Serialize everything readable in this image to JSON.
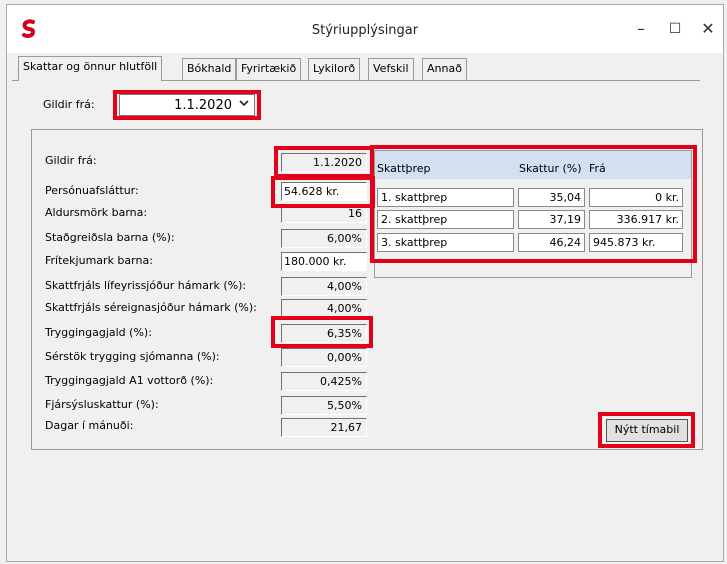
{
  "window": {
    "title": "Stýriupplýsingar",
    "minimize": "–",
    "maximize": "☐",
    "close": "✕"
  },
  "tabs": [
    {
      "label": "Skattar og önnur hlutföll",
      "active": true
    },
    {
      "label": "Bókhald"
    },
    {
      "label": "Fyrirtækið"
    },
    {
      "label": "Lykilorð"
    },
    {
      "label": "Vefskil"
    },
    {
      "label": "Annað"
    }
  ],
  "gildir_fra": {
    "label": "Gildir frá:",
    "value": "1.1.2020"
  },
  "fields": [
    {
      "label": "Gildir frá:",
      "value": "1.1.2020"
    },
    {
      "label": "Persónuafsláttur:",
      "value": "54.628 kr."
    },
    {
      "label": "Aldursmörk barna:",
      "value": "16"
    },
    {
      "label": "Staðgreiðsla barna (%):",
      "value": "6,00%"
    },
    {
      "label": "Frítekjumark barna:",
      "value": "180.000 kr."
    },
    {
      "label": "Skattfrjáls lífeyrissjóður hámark (%):",
      "value": "4,00%"
    },
    {
      "label": "Skattfrjáls séreignasjóður hámark (%):",
      "value": "4,00%"
    },
    {
      "label": "Tryggingagjald (%):",
      "value": "6,35%"
    },
    {
      "label": "Sérstök trygging sjómanna (%):",
      "value": "0,00%"
    },
    {
      "label": "Tryggingagjald A1 vottorð (%):",
      "value": "0,425%"
    },
    {
      "label": "Fjársýsluskattur (%):",
      "value": "5,50%"
    },
    {
      "label": "Dagar í mánuði:",
      "value": "21,67"
    }
  ],
  "tax_table": {
    "headers": [
      "Skattþrep",
      "Skattur (%)",
      "Frá"
    ],
    "rows": [
      [
        "1. skattþrep",
        "35,04",
        "0 kr."
      ],
      [
        "2. skattþrep",
        "37,19",
        "336.917 kr."
      ],
      [
        "3. skattþrep",
        "46,24",
        "945.873 kr."
      ]
    ]
  },
  "new_period_button": "Nýtt tímabil",
  "colors": {
    "highlight": "#e3001b",
    "grid_header": "#d4e0ef",
    "background": "#f0f0f0"
  }
}
